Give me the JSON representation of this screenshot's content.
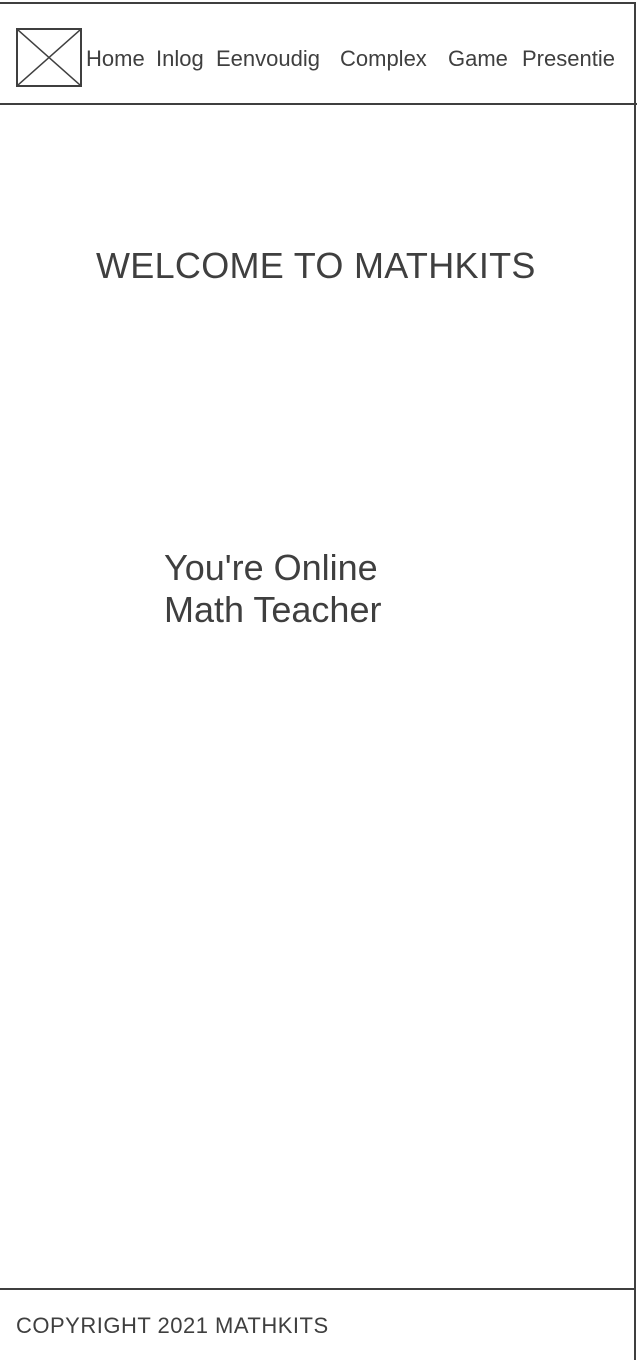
{
  "header": {
    "logo_icon": "image-placeholder-icon",
    "nav": [
      {
        "label": "Home"
      },
      {
        "label": "Inlog"
      },
      {
        "label": "Eenvoudig"
      },
      {
        "label": "Complex"
      },
      {
        "label": "Game"
      },
      {
        "label": "Presentie"
      }
    ]
  },
  "main": {
    "title": "WELCOME TO MATHKITS",
    "tagline_line1": "You're Online",
    "tagline_line2": "Math Teacher"
  },
  "footer": {
    "copyright": "COPYRIGHT 2021 MATHKITS"
  }
}
